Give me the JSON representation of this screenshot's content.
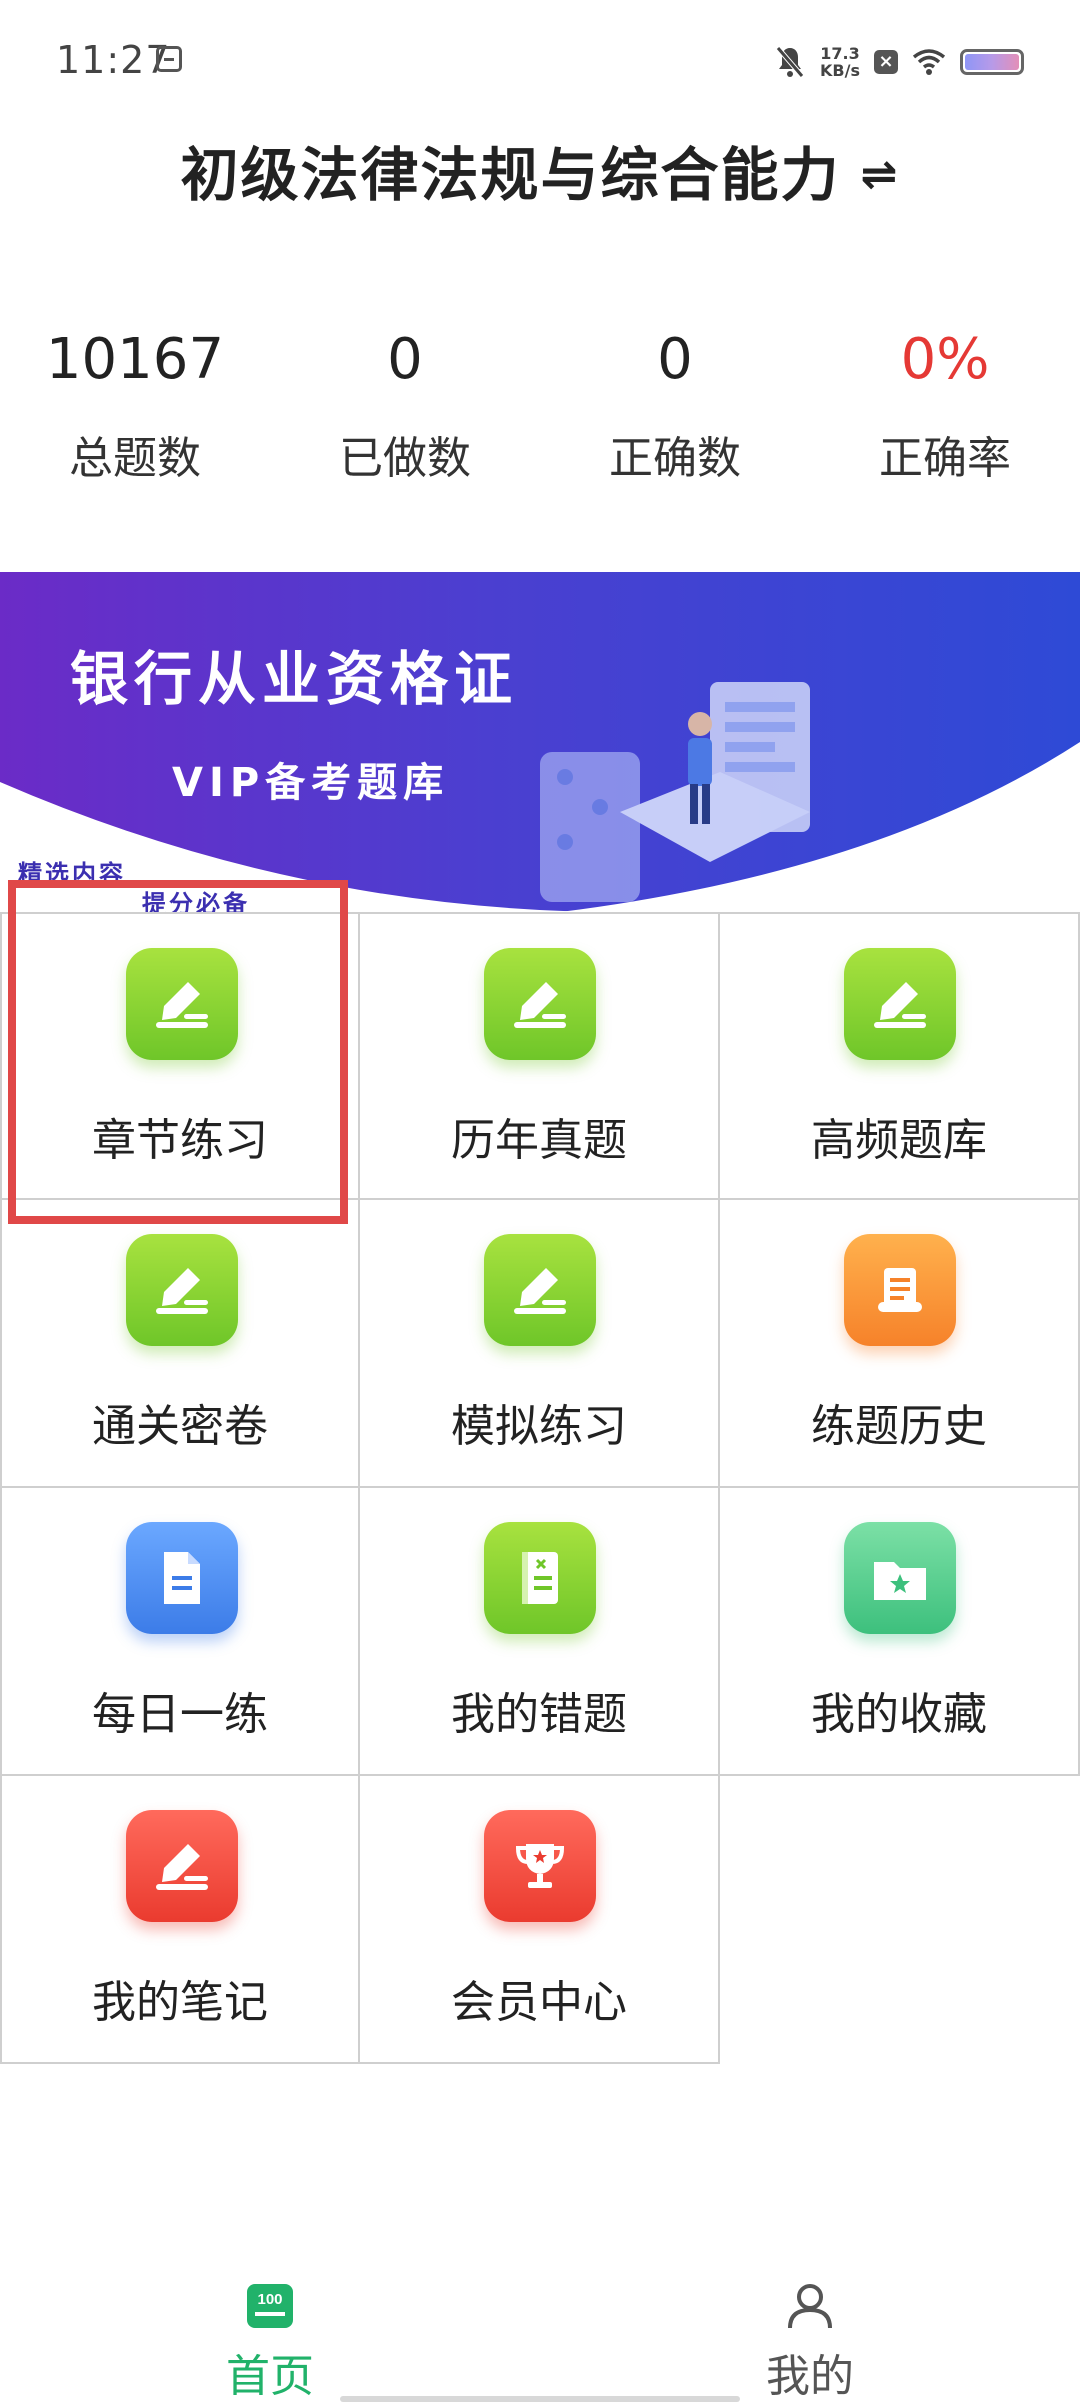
{
  "status_bar": {
    "time": "11:27",
    "speed_value": "17.3",
    "speed_unit": "KB/s"
  },
  "header": {
    "title": "初级法律法规与综合能力",
    "switch_icon": "⇌"
  },
  "stats": [
    {
      "value": "10167",
      "label": "总题数"
    },
    {
      "value": "0",
      "label": "已做数"
    },
    {
      "value": "0",
      "label": "正确数"
    },
    {
      "value": "0%",
      "label": "正确率"
    }
  ],
  "banner": {
    "title": "银行从业资格证",
    "subtitle": "VIP备考题库",
    "tag1": "精选内容",
    "tag2": "提分必备"
  },
  "grid": [
    {
      "label": "章节练习",
      "icon": "pencil-icon",
      "color": "green"
    },
    {
      "label": "历年真题",
      "icon": "pencil-icon",
      "color": "green"
    },
    {
      "label": "高频题库",
      "icon": "pencil-icon",
      "color": "green"
    },
    {
      "label": "通关密卷",
      "icon": "pencil-icon",
      "color": "green"
    },
    {
      "label": "模拟练习",
      "icon": "pencil-icon",
      "color": "green"
    },
    {
      "label": "练题历史",
      "icon": "scroll-icon",
      "color": "orange"
    },
    {
      "label": "每日一练",
      "icon": "document-icon",
      "color": "blue"
    },
    {
      "label": "我的错题",
      "icon": "notebook-icon",
      "color": "green"
    },
    {
      "label": "我的收藏",
      "icon": "star-folder-icon",
      "color": "teal"
    },
    {
      "label": "我的笔记",
      "icon": "pencil-icon",
      "color": "red"
    },
    {
      "label": "会员中心",
      "icon": "trophy-icon",
      "color": "red"
    }
  ],
  "bottom_nav": {
    "home_label": "首页",
    "home_badge": "100",
    "mine_label": "我的"
  },
  "colors": {
    "accent_green": "#21b26a",
    "highlight_red": "#e04848",
    "rate_red": "#e53935"
  }
}
